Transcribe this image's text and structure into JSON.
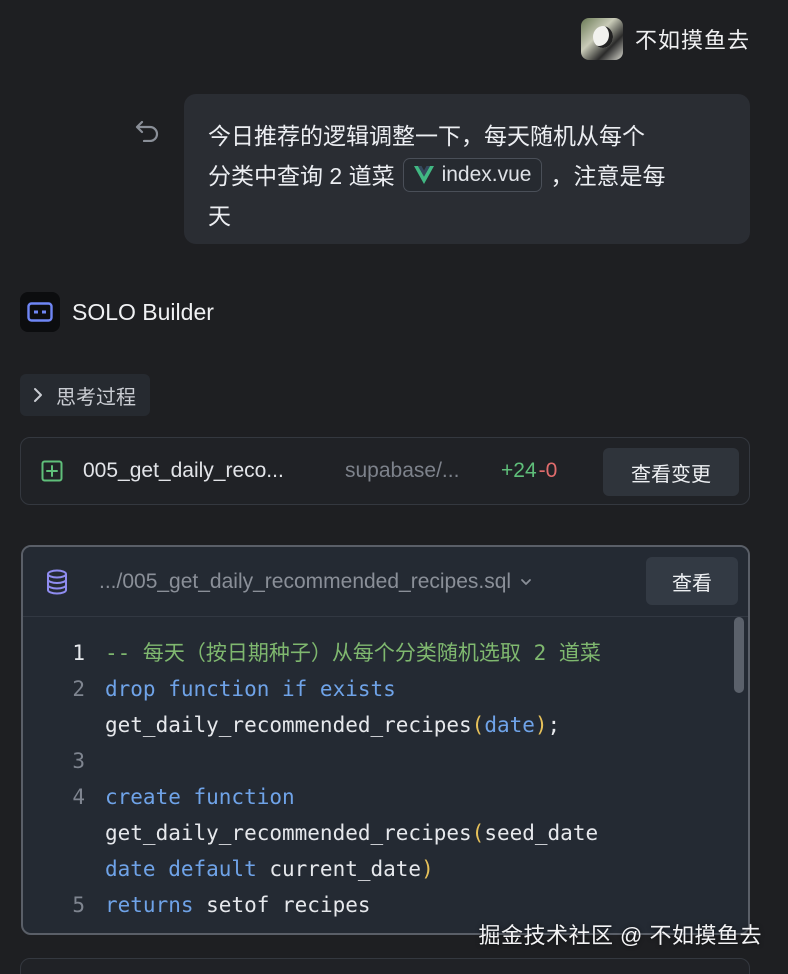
{
  "user": {
    "name": "不如摸鱼去"
  },
  "prompt": {
    "line1": "今日推荐的逻辑调整一下，每天随机从每个",
    "line2_before": "分类中查询 2 道菜",
    "chip_file": "index.vue",
    "line2_after": "，注意是每",
    "line3": "天"
  },
  "builder": {
    "title": "SOLO Builder"
  },
  "thinking": {
    "label": "思考过程"
  },
  "change": {
    "file_name": "005_get_daily_reco...",
    "path": "supabase/...",
    "added": "+24",
    "removed": "-0",
    "view_changes_label": "查看变更"
  },
  "code": {
    "file_path": ".../005_get_daily_recommended_recipes.sql",
    "view_label": "查看",
    "lines": [
      {
        "num": "1",
        "segments": [
          {
            "t": "-- 每天（按日期种子）从每个分类随机选取 2 道菜",
            "k": "comment"
          }
        ]
      },
      {
        "num": "2",
        "segments": [
          {
            "t": "drop function if exists",
            "k": "kw"
          }
        ]
      },
      {
        "num": "",
        "segments": [
          {
            "t": "get_daily_recommended_recipes",
            "k": "text"
          },
          {
            "t": "(",
            "k": "paren"
          },
          {
            "t": "date",
            "k": "kw"
          },
          {
            "t": ")",
            "k": "paren"
          },
          {
            "t": ";",
            "k": "text"
          }
        ]
      },
      {
        "num": "3",
        "segments": [
          {
            "t": "",
            "k": "text"
          }
        ]
      },
      {
        "num": "4",
        "segments": [
          {
            "t": "create function",
            "k": "kw"
          }
        ]
      },
      {
        "num": "",
        "segments": [
          {
            "t": "get_daily_recommended_recipes",
            "k": "text"
          },
          {
            "t": "(",
            "k": "paren"
          },
          {
            "t": "seed_date",
            "k": "text"
          }
        ]
      },
      {
        "num": "",
        "segments": [
          {
            "t": "date default",
            "k": "kw"
          },
          {
            "t": " current_date",
            "k": "text"
          },
          {
            "t": ")",
            "k": "paren"
          }
        ]
      },
      {
        "num": "5",
        "segments": [
          {
            "t": "returns",
            "k": "kw"
          },
          {
            "t": " setof recipes",
            "k": "text"
          }
        ]
      }
    ]
  },
  "watermark": "掘金技术社区 @ 不如摸鱼去",
  "colors": {
    "background": "#1e1f22",
    "bubble": "#2a2d33",
    "code_bg": "#242a33",
    "added": "#5fbf7a",
    "removed": "#e06c6c",
    "keyword": "#6fa3e8",
    "comment": "#7fb86f",
    "paren": "#e6c15a",
    "vue_green": "#41b883"
  }
}
